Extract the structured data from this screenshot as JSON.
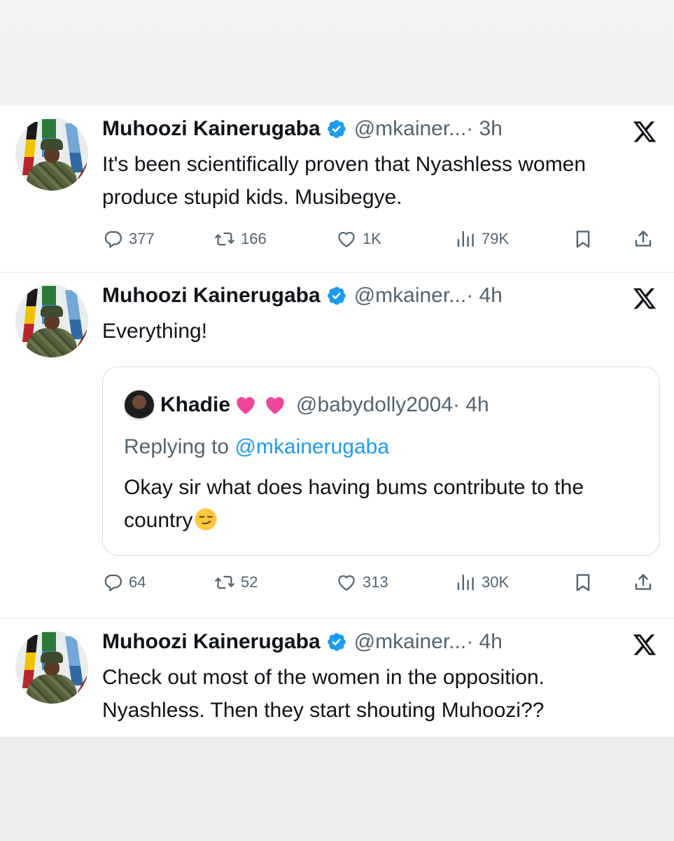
{
  "tweets": [
    {
      "name": "Muhoozi Kainerugaba",
      "handle": "@mkainer...",
      "time": "· 3h",
      "text": "It's been scientifically proven that Nyashless women produce stupid kids. Musibegye.",
      "stats": {
        "replies": "377",
        "retweets": "166",
        "likes": "1K",
        "views": "79K"
      }
    },
    {
      "name": "Muhoozi Kainerugaba",
      "handle": "@mkainer...",
      "time": "· 4h",
      "text": "Everything!",
      "quote": {
        "name": "Khadie",
        "handle": "@babydolly2004",
        "time": "· 4h",
        "replying_prefix": "Replying to ",
        "replying_mention": "@mkainerugaba",
        "text": "Okay sir what does having bums contribute to the country"
      },
      "stats": {
        "replies": "64",
        "retweets": "52",
        "likes": "313",
        "views": "30K"
      }
    },
    {
      "name": "Muhoozi Kainerugaba",
      "handle": "@mkainer...",
      "time": "· 4h",
      "text": "Check out most of the women in the opposition. Nyashless. Then they start shouting Muhoozi??"
    }
  ],
  "icons": {
    "reply": "reply-icon",
    "retweet": "retweet-icon",
    "like": "heart-icon",
    "views": "views-icon",
    "bookmark": "bookmark-icon",
    "share": "share-icon",
    "verified": "verified-badge-icon",
    "platform": "x-logo-icon"
  },
  "colors": {
    "text": "#0f1419",
    "secondary": "#536471",
    "link": "#1d9bf0",
    "verified": "#1d9bf0",
    "heart_emoji": "#f0449a"
  }
}
